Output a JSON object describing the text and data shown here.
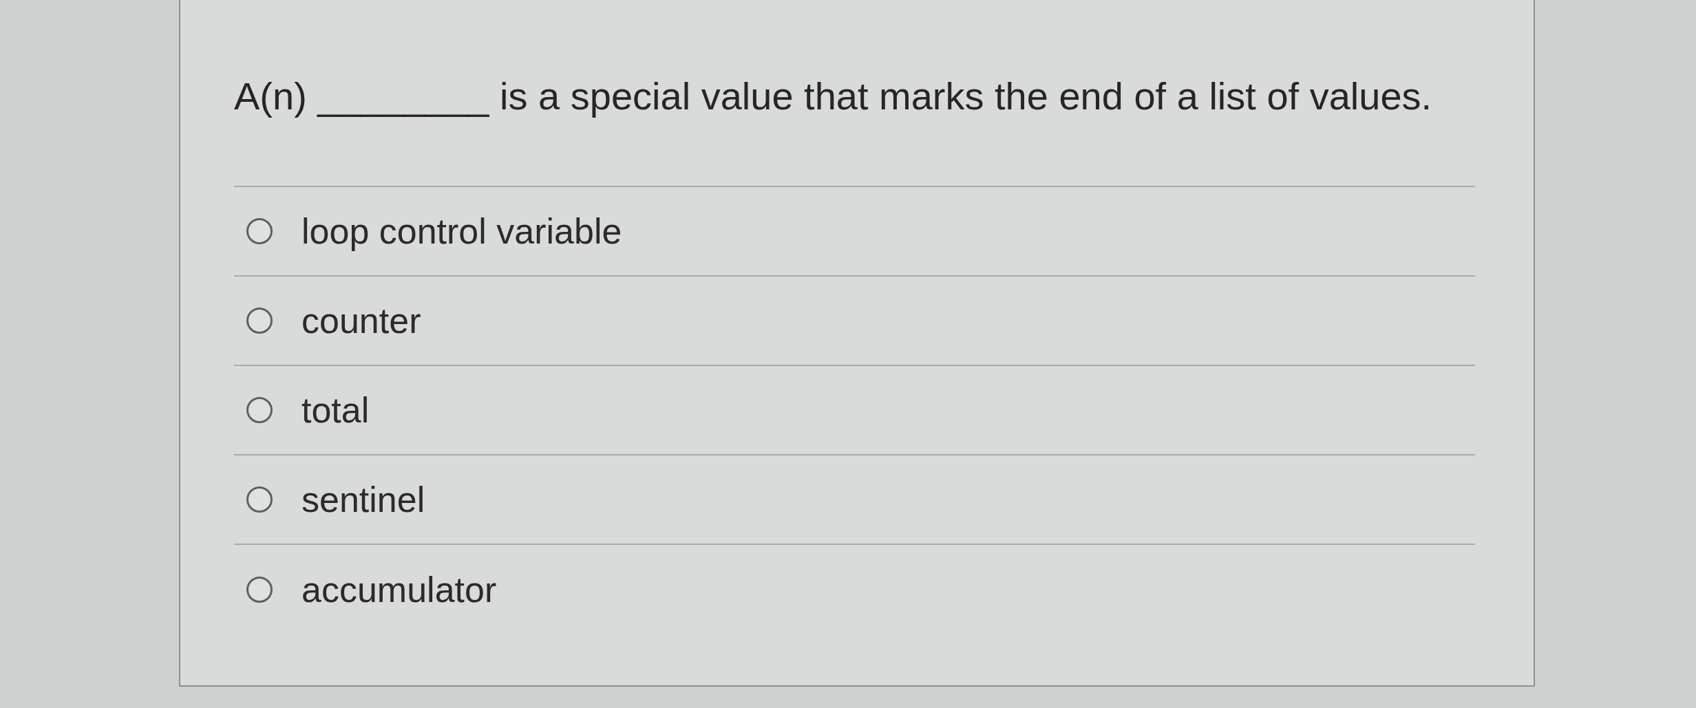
{
  "question": {
    "text": "A(n) ________ is a special value that marks the end of a list of values."
  },
  "options": [
    {
      "label": "loop control variable",
      "selected": false
    },
    {
      "label": "counter",
      "selected": false
    },
    {
      "label": "total",
      "selected": false
    },
    {
      "label": "sentinel",
      "selected": false
    },
    {
      "label": "accumulator",
      "selected": false
    }
  ]
}
